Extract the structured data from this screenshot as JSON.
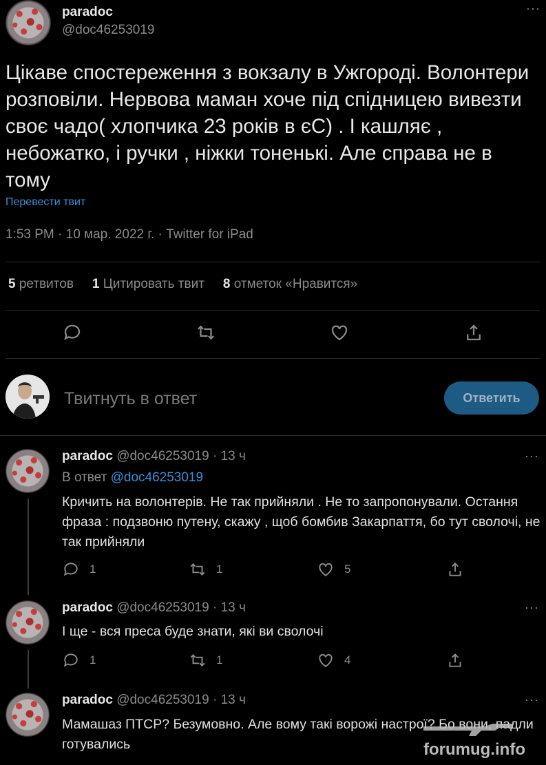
{
  "main_tweet": {
    "name": "paradoc",
    "handle": "@doc46253019",
    "text": "Цікаве спостереження з вокзалу в Ужгороді. Волонтери розповіли. Нервова маман хоче під спідницею вивезти своє чадо( хлопчика 23 років в єС) . І кашляє , небожатко, і ручки , ніжки тоненькі. Але справа не в тому",
    "translate": "Перевести твит",
    "meta": "1:53 PM · 10 мар. 2022 г. · Twitter for iPad",
    "stats": [
      {
        "count": "5",
        "label": "ретвитов"
      },
      {
        "count": "1",
        "label": "Цитировать твит"
      },
      {
        "count": "8",
        "label": "отметок «Нравится»"
      }
    ],
    "more": "···"
  },
  "reply_box": {
    "placeholder": "Твитнуть в ответ",
    "button": "Ответить"
  },
  "replies": [
    {
      "name": "paradoc",
      "handle": "@doc46253019",
      "time": "13 ч",
      "in_reply_label": "В ответ",
      "in_reply_handle": "@doc46253019",
      "text": "Кричить на волонтерів. Не так прийняли . Не то запропонували. Остання фраза : подзвоню путену, скажу , щоб бомбив Закарпаття, бо тут сволочі, не так прийняли",
      "replies": "1",
      "retweets": "1",
      "likes": "5"
    },
    {
      "name": "paradoc",
      "handle": "@doc46253019",
      "time": "13 ч",
      "text": "І ще - вся преса буде знати, які ви сволочі",
      "replies": "1",
      "retweets": "1",
      "likes": "4"
    },
    {
      "name": "paradoc",
      "handle": "@doc46253019",
      "time": "13 ч",
      "text": "Мамашаз ПТСР? Безумовно. Але вому такі ворожі настрої? Бо вони, падли готувались"
    }
  ],
  "watermark": "forumug.info"
}
